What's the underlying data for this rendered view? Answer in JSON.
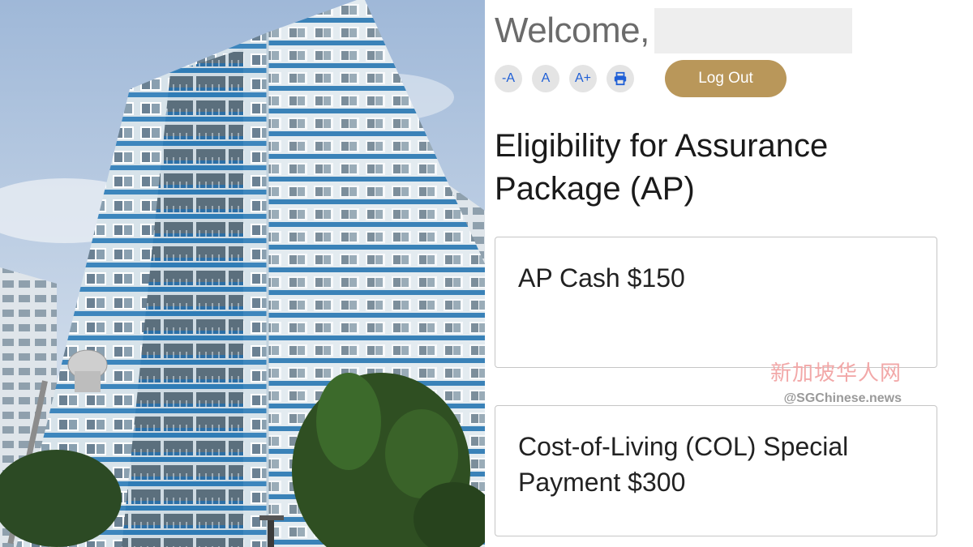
{
  "photo": {
    "subject": "HDB residential block",
    "colors": {
      "sky": "#b9cde4",
      "facade_blue": "#2f7cb6",
      "facade_light": "#d9e6ee",
      "tree": "#2d4a22"
    }
  },
  "header": {
    "welcome": "Welcome,",
    "name": ""
  },
  "controls": {
    "decrease_font": "-A",
    "reset_font": "A",
    "increase_font": "A+",
    "print_icon": "printer-icon",
    "logout": "Log Out"
  },
  "main": {
    "title": "Eligibility for Assurance Package (AP)",
    "cards": [
      {
        "label": "AP Cash $150"
      },
      {
        "label": "Cost-of-Living (COL) Special Payment $300"
      }
    ]
  },
  "watermark": {
    "chinese": "新加坡华人网",
    "handle": "@SGChinese.news"
  },
  "colors": {
    "accent_gold": "#b9975a",
    "icon_blue": "#1f5fd6",
    "text_gray": "#6b6b6b"
  }
}
